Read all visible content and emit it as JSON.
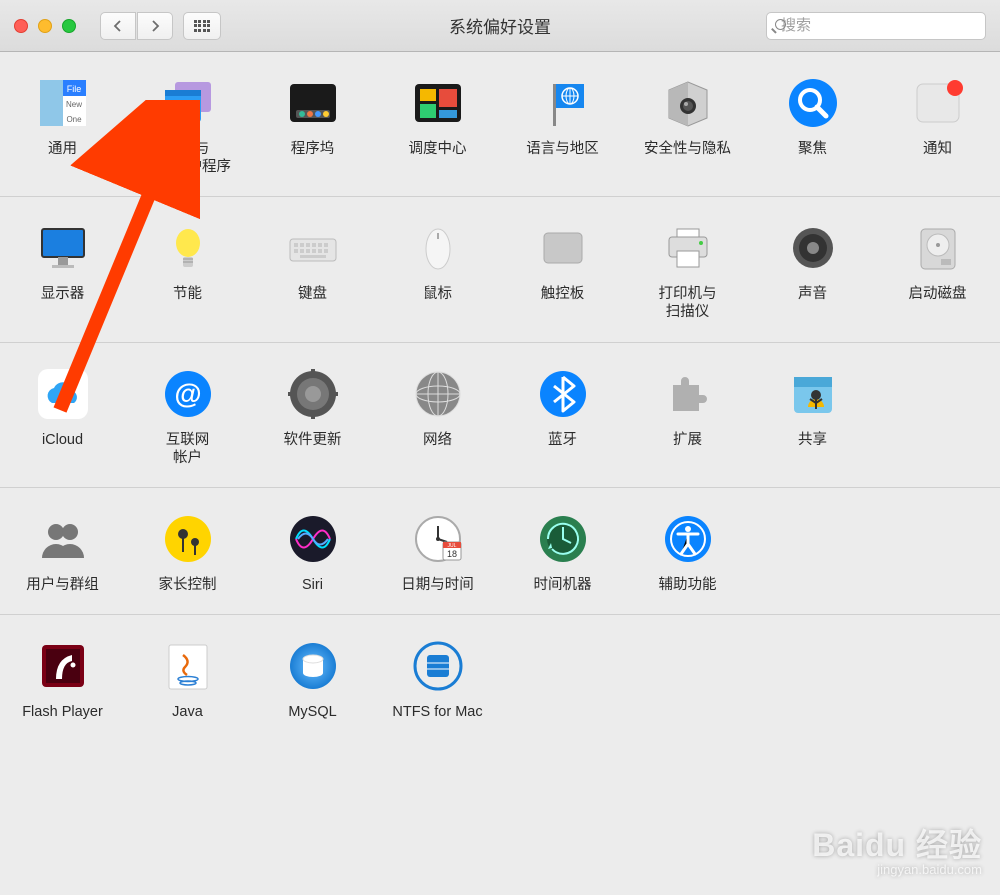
{
  "window": {
    "title": "系统偏好设置",
    "search_placeholder": "搜索"
  },
  "rows": [
    {
      "items": [
        {
          "id": "general",
          "label": "通用"
        },
        {
          "id": "desktop",
          "label": "桌面与\n屏幕保护程序"
        },
        {
          "id": "dock",
          "label": "程序坞"
        },
        {
          "id": "mission",
          "label": "调度中心"
        },
        {
          "id": "language",
          "label": "语言与地区"
        },
        {
          "id": "security",
          "label": "安全性与隐私"
        },
        {
          "id": "spotlight",
          "label": "聚焦"
        },
        {
          "id": "notifications",
          "label": "通知"
        }
      ]
    },
    {
      "items": [
        {
          "id": "displays",
          "label": "显示器"
        },
        {
          "id": "energy",
          "label": "节能"
        },
        {
          "id": "keyboard",
          "label": "键盘"
        },
        {
          "id": "mouse",
          "label": "鼠标"
        },
        {
          "id": "trackpad",
          "label": "触控板"
        },
        {
          "id": "printer",
          "label": "打印机与\n扫描仪"
        },
        {
          "id": "sound",
          "label": "声音"
        },
        {
          "id": "startup",
          "label": "启动磁盘"
        }
      ]
    },
    {
      "items": [
        {
          "id": "icloud",
          "label": "iCloud"
        },
        {
          "id": "internet",
          "label": "互联网\n帐户"
        },
        {
          "id": "software",
          "label": "软件更新"
        },
        {
          "id": "network",
          "label": "网络"
        },
        {
          "id": "bluetooth",
          "label": "蓝牙"
        },
        {
          "id": "extensions",
          "label": "扩展"
        },
        {
          "id": "sharing",
          "label": "共享"
        }
      ]
    },
    {
      "items": [
        {
          "id": "users",
          "label": "用户与群组"
        },
        {
          "id": "parental",
          "label": "家长控制"
        },
        {
          "id": "siri",
          "label": "Siri"
        },
        {
          "id": "datetime",
          "label": "日期与时间"
        },
        {
          "id": "timemachine",
          "label": "时间机器"
        },
        {
          "id": "accessibility",
          "label": "辅助功能"
        }
      ]
    },
    {
      "items": [
        {
          "id": "flash",
          "label": "Flash Player"
        },
        {
          "id": "java",
          "label": "Java"
        },
        {
          "id": "mysql",
          "label": "MySQL"
        },
        {
          "id": "ntfs",
          "label": "NTFS for Mac"
        }
      ]
    }
  ],
  "watermark": {
    "main": "Baidu 经验",
    "sub": "jingyan.baidu.com"
  }
}
